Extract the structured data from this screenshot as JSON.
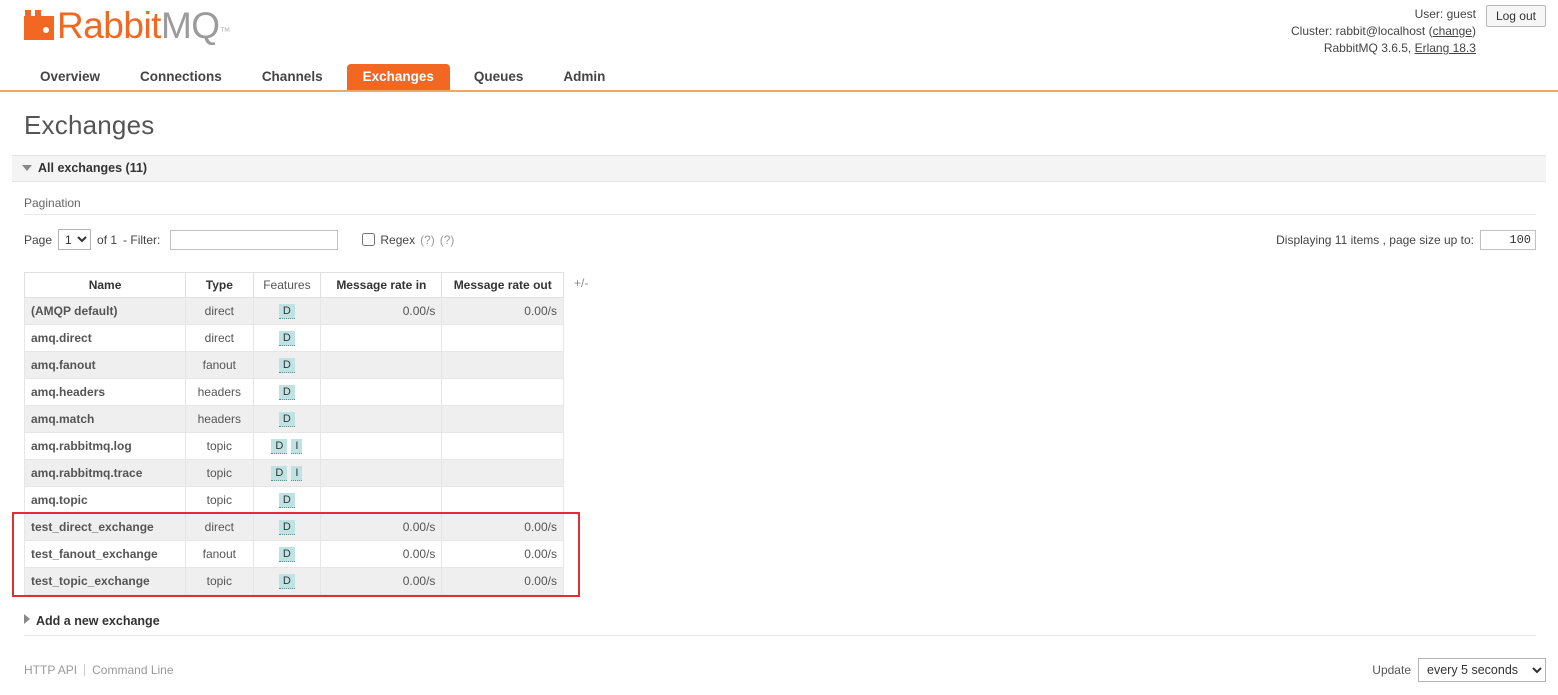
{
  "header": {
    "logo_rabbit": "Rabbit",
    "logo_mq": "MQ",
    "logo_tm": "™",
    "user_label": "User:",
    "user_name": "guest",
    "cluster_label": "Cluster:",
    "cluster_name": "rabbit@localhost",
    "cluster_change": "change",
    "version_line": "RabbitMQ 3.6.5,",
    "erlang_version": "Erlang 18.3",
    "logout_label": "Log out"
  },
  "nav": {
    "tabs": [
      {
        "label": "Overview",
        "active": false
      },
      {
        "label": "Connections",
        "active": false
      },
      {
        "label": "Channels",
        "active": false
      },
      {
        "label": "Exchanges",
        "active": true
      },
      {
        "label": "Queues",
        "active": false
      },
      {
        "label": "Admin",
        "active": false
      }
    ],
    "active_color": "#f26722"
  },
  "page": {
    "title": "Exchanges",
    "section_header": "All exchanges (11)",
    "pagination_label": "Pagination",
    "add_section_label": "Add a new exchange"
  },
  "pagination": {
    "page_label": "Page",
    "page_value": "1",
    "page_options": [
      "1"
    ],
    "of_label": "of 1",
    "filter_label": "- Filter:",
    "filter_value": "",
    "filter_placeholder": "",
    "regex_label": "Regex",
    "regex_checked": false,
    "help1": "(?)",
    "help2": "(?)",
    "displaying_text": "Displaying 11 items , page size up to:",
    "page_size_value": "100"
  },
  "table": {
    "columns": [
      "Name",
      "Type",
      "Features",
      "Message rate in",
      "Message rate out"
    ],
    "column_toggle": "+/-",
    "rows": [
      {
        "name": "(AMQP default)",
        "type": "direct",
        "features": [
          "D"
        ],
        "rate_in": "0.00/s",
        "rate_out": "0.00/s",
        "highlighted": false
      },
      {
        "name": "amq.direct",
        "type": "direct",
        "features": [
          "D"
        ],
        "rate_in": "",
        "rate_out": "",
        "highlighted": false
      },
      {
        "name": "amq.fanout",
        "type": "fanout",
        "features": [
          "D"
        ],
        "rate_in": "",
        "rate_out": "",
        "highlighted": false
      },
      {
        "name": "amq.headers",
        "type": "headers",
        "features": [
          "D"
        ],
        "rate_in": "",
        "rate_out": "",
        "highlighted": false
      },
      {
        "name": "amq.match",
        "type": "headers",
        "features": [
          "D"
        ],
        "rate_in": "",
        "rate_out": "",
        "highlighted": false
      },
      {
        "name": "amq.rabbitmq.log",
        "type": "topic",
        "features": [
          "D",
          "I"
        ],
        "rate_in": "",
        "rate_out": "",
        "highlighted": false
      },
      {
        "name": "amq.rabbitmq.trace",
        "type": "topic",
        "features": [
          "D",
          "I"
        ],
        "rate_in": "",
        "rate_out": "",
        "highlighted": false
      },
      {
        "name": "amq.topic",
        "type": "topic",
        "features": [
          "D"
        ],
        "rate_in": "",
        "rate_out": "",
        "highlighted": false
      },
      {
        "name": "test_direct_exchange",
        "type": "direct",
        "features": [
          "D"
        ],
        "rate_in": "0.00/s",
        "rate_out": "0.00/s",
        "highlighted": true
      },
      {
        "name": "test_fanout_exchange",
        "type": "fanout",
        "features": [
          "D"
        ],
        "rate_in": "0.00/s",
        "rate_out": "0.00/s",
        "highlighted": true
      },
      {
        "name": "test_topic_exchange",
        "type": "topic",
        "features": [
          "D"
        ],
        "rate_in": "0.00/s",
        "rate_out": "0.00/s",
        "highlighted": true
      }
    ],
    "highlight_color": "#e03131",
    "feature_badge_color": "#bfe3e3"
  },
  "footer": {
    "http_api": "HTTP API",
    "command_line": "Command Line",
    "update_label": "Update",
    "update_value": "every 5 seconds",
    "update_options": [
      "every 5 seconds"
    ]
  }
}
